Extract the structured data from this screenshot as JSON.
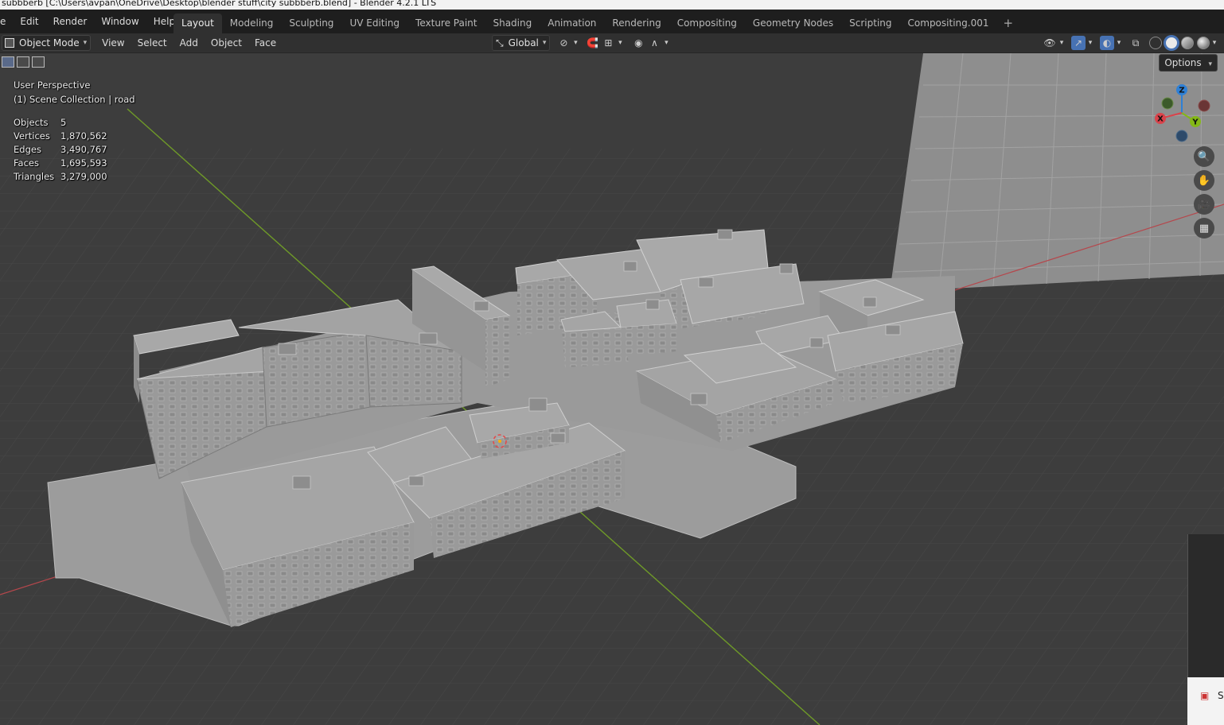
{
  "window": {
    "title": "subbberb [C:\\Users\\avpan\\OneDrive\\Desktop\\blender stuff\\city subbberb.blend] - Blender 4.2.1 LTS"
  },
  "menu": {
    "items": [
      "e",
      "Edit",
      "Render",
      "Window",
      "Help"
    ]
  },
  "workspaces": {
    "tabs": [
      "Layout",
      "Modeling",
      "Sculpting",
      "UV Editing",
      "Texture Paint",
      "Shading",
      "Animation",
      "Rendering",
      "Compositing",
      "Geometry Nodes",
      "Scripting",
      "Compositing.001"
    ],
    "active": "Layout",
    "add": "+"
  },
  "header": {
    "mode": "Object Mode",
    "menus": [
      "View",
      "Select",
      "Add",
      "Object",
      "Face"
    ],
    "orientation": "Global"
  },
  "viewport": {
    "view_name": "User Perspective",
    "collection": "(1) Scene Collection | road",
    "options_label": "Options",
    "stats": [
      {
        "label": "Objects",
        "value": "5"
      },
      {
        "label": "Vertices",
        "value": "1,870,562"
      },
      {
        "label": "Edges",
        "value": "3,490,767"
      },
      {
        "label": "Faces",
        "value": "1,695,593"
      },
      {
        "label": "Triangles",
        "value": "3,279,000"
      }
    ]
  },
  "gizmo": {
    "axes": {
      "x": "X",
      "y": "Y",
      "z": "Z"
    },
    "colors": {
      "x": "#d9434b",
      "y": "#84b816",
      "z": "#2e80d6"
    }
  },
  "nav_buttons": [
    "zoom-icon",
    "hand-pan-icon",
    "camera-icon",
    "grid-ortho-icon"
  ],
  "taskbar": {
    "label": "S"
  }
}
